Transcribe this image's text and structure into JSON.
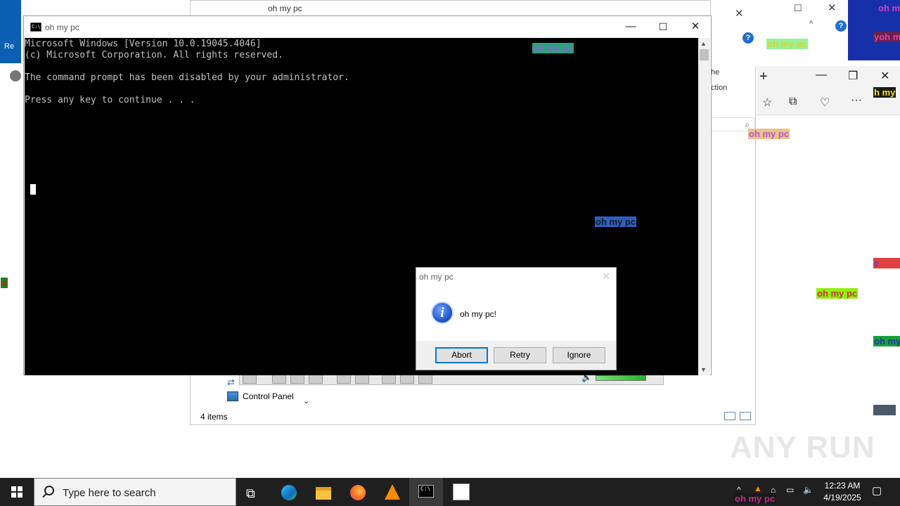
{
  "cmd": {
    "title": "oh my pc",
    "lines": [
      "Microsoft Windows [Version 10.0.19045.4046]",
      "(c) Microsoft Corporation. All rights reserved.",
      "",
      "The command prompt has been disabled by your administrator.",
      "",
      "Press any key to continue . . ."
    ],
    "minimize": "—",
    "maximize": "☐",
    "close": "✕"
  },
  "msgbox": {
    "title": "oh my pc",
    "message": "oh my pc!",
    "buttons": {
      "abort": "Abort",
      "retry": "Retry",
      "ignore": "Ignore"
    },
    "close": "✕",
    "info_glyph": "i"
  },
  "explorer": {
    "item": "Control Panel",
    "status": "4 items",
    "title_fragment": "oh my pc",
    "side_text_1": "he",
    "side_text_2": "ction"
  },
  "desktop": {
    "left_label": "Re"
  },
  "taskbar": {
    "search_placeholder": "Type here to search",
    "time": "12:23 AM",
    "date": "4/19/2025"
  },
  "tags": [
    {
      "text": "oh my pc",
      "color": "#8a63d2",
      "bg": "#2aa37a"
    },
    {
      "text": "oh my pc",
      "color": "#1a1a1a",
      "bg": "#2b5fc2"
    },
    {
      "text": "oh my pc",
      "color": "#c04fd8",
      "bg": "#e8c48a"
    },
    {
      "text": "oh my pc",
      "color": "#d8d828",
      "bg": "#96f2a0"
    },
    {
      "text": "oh my pc",
      "color": "#c83232",
      "bg": "#90f010"
    },
    {
      "text": "oh my pc",
      "color": "#2233aa",
      "bg": "#1aa03a"
    },
    {
      "text": "oh my pc",
      "color": "#c02a8a",
      "bg": "#1a1a1a"
    }
  ],
  "partial_tags": [
    {
      "text": "oh my pc",
      "color": "#d040d0",
      "bg": "#1530a8"
    },
    {
      "text": "yoh my",
      "color": "#e040a0",
      "bg": "#6a2050"
    },
    {
      "text": "h my",
      "color": "#f0e020",
      "bg": "#1a1a1a"
    },
    {
      "text": "c",
      "color": "#4040ff",
      "bg": "#e04040"
    },
    {
      "text": "d",
      "color": "#c02020",
      "bg": "#208020"
    }
  ],
  "watermark": "ANY RUN",
  "colors": {
    "taskbar": "#1f1f1f",
    "cmd_bg": "#000000",
    "cmd_text": "#c0c0c0",
    "accent": "#0078d7"
  }
}
